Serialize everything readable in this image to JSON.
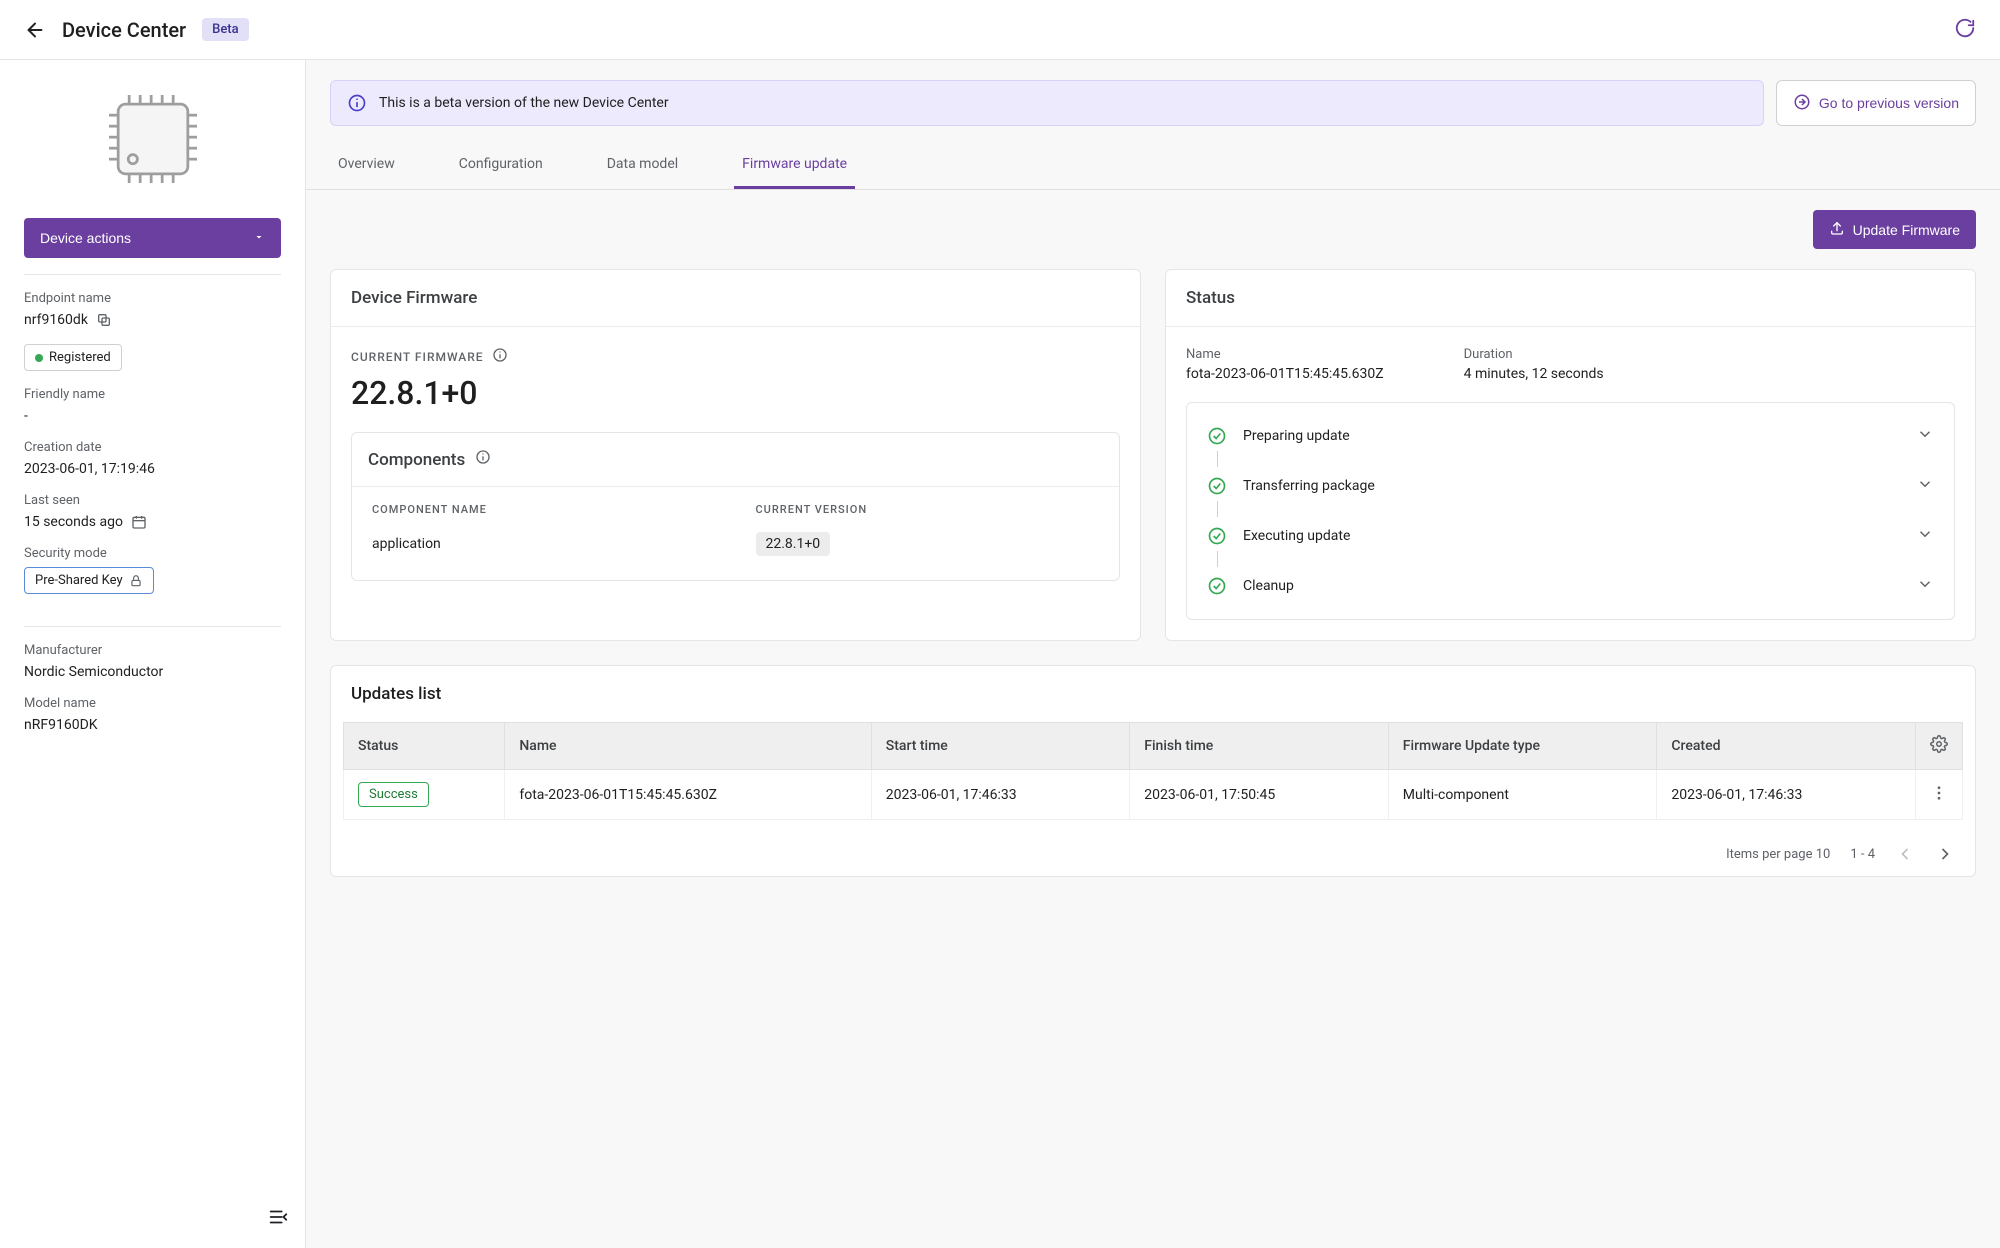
{
  "header": {
    "title": "Device Center",
    "beta_label": "Beta"
  },
  "banner": {
    "text": "This is a beta version of the new Device Center",
    "previous_link": "Go to previous version"
  },
  "sidebar": {
    "device_actions_label": "Device actions",
    "endpoint_label": "Endpoint name",
    "endpoint_value": "nrf9160dk",
    "registered_label": "Registered",
    "friendly_label": "Friendly name",
    "friendly_value": "-",
    "creation_label": "Creation date",
    "creation_value": "2023-06-01, 17:19:46",
    "lastseen_label": "Last seen",
    "lastseen_value": "15 seconds ago",
    "security_label": "Security mode",
    "security_value": "Pre-Shared Key",
    "manufacturer_label": "Manufacturer",
    "manufacturer_value": "Nordic Semiconductor",
    "model_label": "Model name",
    "model_value": "nRF9160DK"
  },
  "tabs": {
    "overview": "Overview",
    "configuration": "Configuration",
    "datamodel": "Data model",
    "firmware": "Firmware update"
  },
  "actions": {
    "update_firmware": "Update Firmware"
  },
  "firmware_card": {
    "title": "Device Firmware",
    "current_label": "CURRENT FIRMWARE",
    "version": "22.8.1+0",
    "components_title": "Components",
    "component_name_header": "COMPONENT NAME",
    "current_version_header": "CURRENT VERSION",
    "component_name": "application",
    "component_version": "22.8.1+0"
  },
  "status_card": {
    "title": "Status",
    "name_label": "Name",
    "name_value": "fota-2023-06-01T15:45:45.630Z",
    "duration_label": "Duration",
    "duration_value": "4 minutes, 12 seconds",
    "steps": {
      "prepare": "Preparing update",
      "transfer": "Transferring package",
      "execute": "Executing update",
      "cleanup": "Cleanup"
    }
  },
  "updates_card": {
    "title": "Updates list",
    "columns": {
      "status": "Status",
      "name": "Name",
      "start": "Start time",
      "finish": "Finish time",
      "type": "Firmware Update type",
      "created": "Created"
    },
    "row": {
      "status": "Success",
      "name": "fota-2023-06-01T15:45:45.630Z",
      "start": "2023-06-01, 17:46:33",
      "finish": "2023-06-01, 17:50:45",
      "type": "Multi-component",
      "created": "2023-06-01, 17:46:33"
    },
    "paginator": {
      "items_per_page_label": "Items per page",
      "items_per_page_value": "10",
      "range": "1 - 4"
    }
  }
}
